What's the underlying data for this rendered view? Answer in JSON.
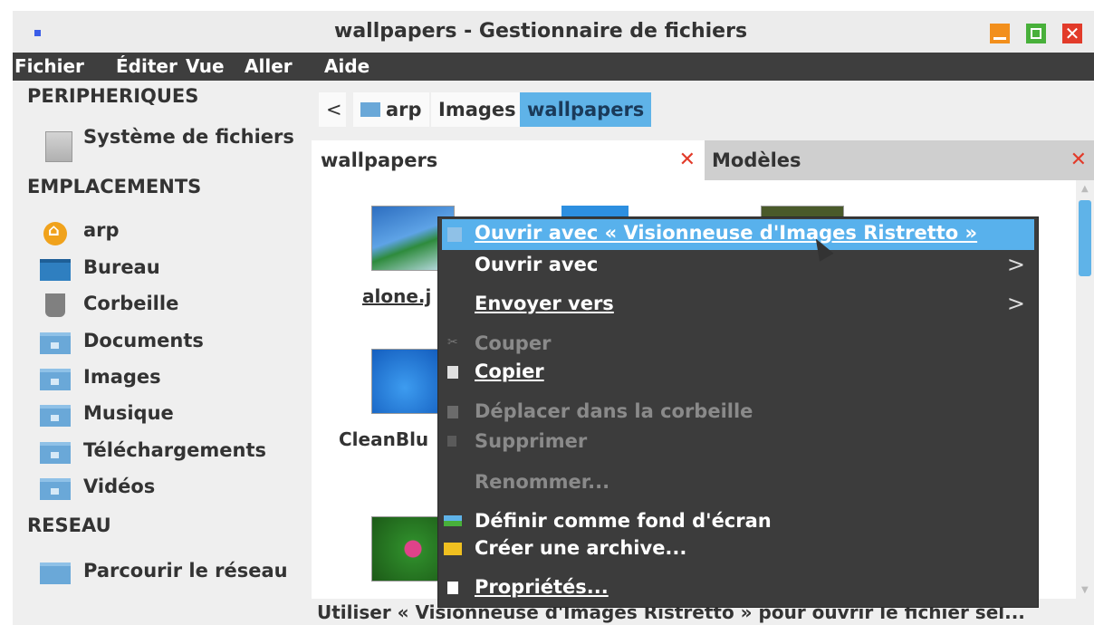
{
  "window": {
    "title": "wallpapers - Gestionnaire de fichiers",
    "close_glyph": "✕"
  },
  "menubar": [
    "Fichier",
    "Éditer",
    "Vue",
    "Aller",
    "Aide"
  ],
  "sidebar": {
    "sections": [
      {
        "title": "PERIPHERIQUES",
        "items": [
          {
            "label": "Système de fichiers",
            "icon": "drive-icon"
          }
        ]
      },
      {
        "title": "EMPLACEMENTS",
        "items": [
          {
            "label": "arp",
            "icon": "home-icon"
          },
          {
            "label": "Bureau",
            "icon": "desktop-icon"
          },
          {
            "label": "Corbeille",
            "icon": "trash-icon"
          },
          {
            "label": "Documents",
            "icon": "folder-documents-icon"
          },
          {
            "label": "Images",
            "icon": "folder-images-icon"
          },
          {
            "label": "Musique",
            "icon": "folder-music-icon"
          },
          {
            "label": "Téléchargements",
            "icon": "folder-downloads-icon"
          },
          {
            "label": "Vidéos",
            "icon": "folder-videos-icon"
          }
        ]
      },
      {
        "title": "RESEAU",
        "items": [
          {
            "label": "Parcourir le réseau",
            "icon": "network-icon"
          }
        ]
      }
    ]
  },
  "pathbar": {
    "back": "<",
    "crumbs": [
      "arp",
      "Images",
      "wallpapers"
    ]
  },
  "tabs": [
    {
      "label": "wallpapers",
      "close": "✕"
    },
    {
      "label": "Modèles",
      "close": "✕"
    }
  ],
  "files": [
    "alone.j",
    "CleanBlu"
  ],
  "statusbar": "Utiliser « Visionneuse d'Images Ristretto » pour ouvrir le fichier sél...",
  "context_menu": {
    "items": [
      {
        "label": "Ouvrir avec « Visionneuse d'Images Ristretto »",
        "state": "highlighted",
        "icon": "image-viewer-icon"
      },
      {
        "label": "Ouvrir avec",
        "state": "normal",
        "submenu": ">"
      },
      {
        "label": "Envoyer vers",
        "state": "normal",
        "submenu": ">"
      },
      {
        "label": "Couper",
        "state": "disabled",
        "icon": "cut-icon"
      },
      {
        "label": "Copier",
        "state": "normal",
        "icon": "copy-icon"
      },
      {
        "label": "Déplacer  dans la corbeille",
        "state": "disabled",
        "icon": "trash-icon"
      },
      {
        "label": "Supprimer",
        "state": "disabled",
        "icon": "delete-icon"
      },
      {
        "label": "Renommer...",
        "state": "disabled"
      },
      {
        "label": "Définir comme fond d'écran",
        "state": "normal",
        "icon": "wallpaper-icon"
      },
      {
        "label": "Créer une archive...",
        "state": "normal",
        "icon": "archive-icon"
      },
      {
        "label": "Propriétés...",
        "state": "normal",
        "icon": "properties-icon"
      }
    ]
  }
}
